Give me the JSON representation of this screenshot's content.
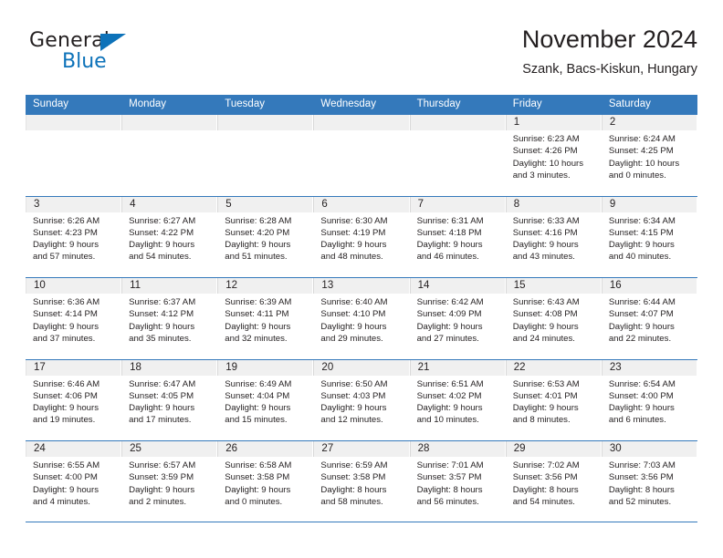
{
  "brand": {
    "name_top": "General",
    "name_bottom": "Blue",
    "accent_color": "#0d72b9"
  },
  "header": {
    "title": "November 2024",
    "subtitle": "Szank, Bacs-Kiskun, Hungary"
  },
  "calendar": {
    "header_bg": "#3479bb",
    "daynum_bg": "#f0f0f0",
    "weekdays": [
      "Sunday",
      "Monday",
      "Tuesday",
      "Wednesday",
      "Thursday",
      "Friday",
      "Saturday"
    ],
    "weeks": [
      [
        {
          "day": "",
          "lines": []
        },
        {
          "day": "",
          "lines": []
        },
        {
          "day": "",
          "lines": []
        },
        {
          "day": "",
          "lines": []
        },
        {
          "day": "",
          "lines": []
        },
        {
          "day": "1",
          "lines": [
            "Sunrise: 6:23 AM",
            "Sunset: 4:26 PM",
            "Daylight: 10 hours",
            "and 3 minutes."
          ]
        },
        {
          "day": "2",
          "lines": [
            "Sunrise: 6:24 AM",
            "Sunset: 4:25 PM",
            "Daylight: 10 hours",
            "and 0 minutes."
          ]
        }
      ],
      [
        {
          "day": "3",
          "lines": [
            "Sunrise: 6:26 AM",
            "Sunset: 4:23 PM",
            "Daylight: 9 hours",
            "and 57 minutes."
          ]
        },
        {
          "day": "4",
          "lines": [
            "Sunrise: 6:27 AM",
            "Sunset: 4:22 PM",
            "Daylight: 9 hours",
            "and 54 minutes."
          ]
        },
        {
          "day": "5",
          "lines": [
            "Sunrise: 6:28 AM",
            "Sunset: 4:20 PM",
            "Daylight: 9 hours",
            "and 51 minutes."
          ]
        },
        {
          "day": "6",
          "lines": [
            "Sunrise: 6:30 AM",
            "Sunset: 4:19 PM",
            "Daylight: 9 hours",
            "and 48 minutes."
          ]
        },
        {
          "day": "7",
          "lines": [
            "Sunrise: 6:31 AM",
            "Sunset: 4:18 PM",
            "Daylight: 9 hours",
            "and 46 minutes."
          ]
        },
        {
          "day": "8",
          "lines": [
            "Sunrise: 6:33 AM",
            "Sunset: 4:16 PM",
            "Daylight: 9 hours",
            "and 43 minutes."
          ]
        },
        {
          "day": "9",
          "lines": [
            "Sunrise: 6:34 AM",
            "Sunset: 4:15 PM",
            "Daylight: 9 hours",
            "and 40 minutes."
          ]
        }
      ],
      [
        {
          "day": "10",
          "lines": [
            "Sunrise: 6:36 AM",
            "Sunset: 4:14 PM",
            "Daylight: 9 hours",
            "and 37 minutes."
          ]
        },
        {
          "day": "11",
          "lines": [
            "Sunrise: 6:37 AM",
            "Sunset: 4:12 PM",
            "Daylight: 9 hours",
            "and 35 minutes."
          ]
        },
        {
          "day": "12",
          "lines": [
            "Sunrise: 6:39 AM",
            "Sunset: 4:11 PM",
            "Daylight: 9 hours",
            "and 32 minutes."
          ]
        },
        {
          "day": "13",
          "lines": [
            "Sunrise: 6:40 AM",
            "Sunset: 4:10 PM",
            "Daylight: 9 hours",
            "and 29 minutes."
          ]
        },
        {
          "day": "14",
          "lines": [
            "Sunrise: 6:42 AM",
            "Sunset: 4:09 PM",
            "Daylight: 9 hours",
            "and 27 minutes."
          ]
        },
        {
          "day": "15",
          "lines": [
            "Sunrise: 6:43 AM",
            "Sunset: 4:08 PM",
            "Daylight: 9 hours",
            "and 24 minutes."
          ]
        },
        {
          "day": "16",
          "lines": [
            "Sunrise: 6:44 AM",
            "Sunset: 4:07 PM",
            "Daylight: 9 hours",
            "and 22 minutes."
          ]
        }
      ],
      [
        {
          "day": "17",
          "lines": [
            "Sunrise: 6:46 AM",
            "Sunset: 4:06 PM",
            "Daylight: 9 hours",
            "and 19 minutes."
          ]
        },
        {
          "day": "18",
          "lines": [
            "Sunrise: 6:47 AM",
            "Sunset: 4:05 PM",
            "Daylight: 9 hours",
            "and 17 minutes."
          ]
        },
        {
          "day": "19",
          "lines": [
            "Sunrise: 6:49 AM",
            "Sunset: 4:04 PM",
            "Daylight: 9 hours",
            "and 15 minutes."
          ]
        },
        {
          "day": "20",
          "lines": [
            "Sunrise: 6:50 AM",
            "Sunset: 4:03 PM",
            "Daylight: 9 hours",
            "and 12 minutes."
          ]
        },
        {
          "day": "21",
          "lines": [
            "Sunrise: 6:51 AM",
            "Sunset: 4:02 PM",
            "Daylight: 9 hours",
            "and 10 minutes."
          ]
        },
        {
          "day": "22",
          "lines": [
            "Sunrise: 6:53 AM",
            "Sunset: 4:01 PM",
            "Daylight: 9 hours",
            "and 8 minutes."
          ]
        },
        {
          "day": "23",
          "lines": [
            "Sunrise: 6:54 AM",
            "Sunset: 4:00 PM",
            "Daylight: 9 hours",
            "and 6 minutes."
          ]
        }
      ],
      [
        {
          "day": "24",
          "lines": [
            "Sunrise: 6:55 AM",
            "Sunset: 4:00 PM",
            "Daylight: 9 hours",
            "and 4 minutes."
          ]
        },
        {
          "day": "25",
          "lines": [
            "Sunrise: 6:57 AM",
            "Sunset: 3:59 PM",
            "Daylight: 9 hours",
            "and 2 minutes."
          ]
        },
        {
          "day": "26",
          "lines": [
            "Sunrise: 6:58 AM",
            "Sunset: 3:58 PM",
            "Daylight: 9 hours",
            "and 0 minutes."
          ]
        },
        {
          "day": "27",
          "lines": [
            "Sunrise: 6:59 AM",
            "Sunset: 3:58 PM",
            "Daylight: 8 hours",
            "and 58 minutes."
          ]
        },
        {
          "day": "28",
          "lines": [
            "Sunrise: 7:01 AM",
            "Sunset: 3:57 PM",
            "Daylight: 8 hours",
            "and 56 minutes."
          ]
        },
        {
          "day": "29",
          "lines": [
            "Sunrise: 7:02 AM",
            "Sunset: 3:56 PM",
            "Daylight: 8 hours",
            "and 54 minutes."
          ]
        },
        {
          "day": "30",
          "lines": [
            "Sunrise: 7:03 AM",
            "Sunset: 3:56 PM",
            "Daylight: 8 hours",
            "and 52 minutes."
          ]
        }
      ]
    ]
  }
}
